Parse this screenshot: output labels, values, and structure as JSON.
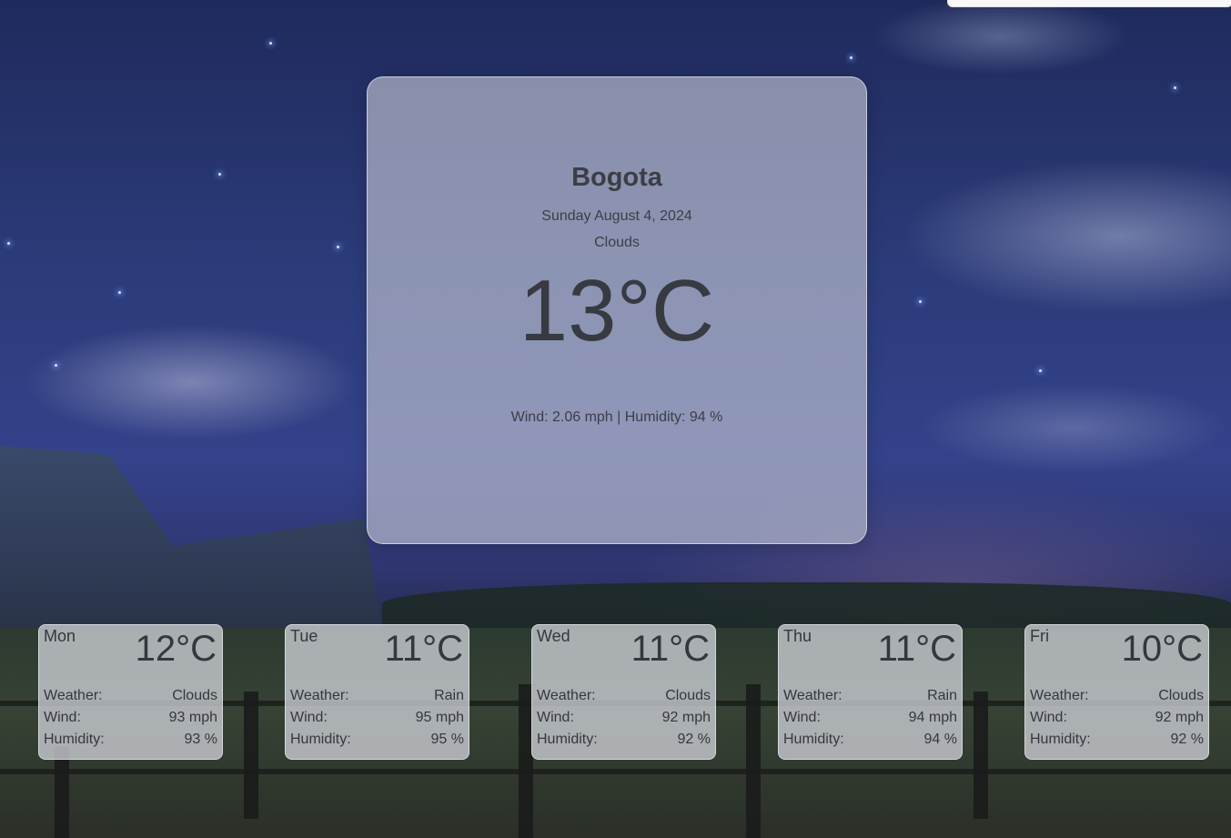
{
  "current": {
    "city": "Bogota",
    "date": "Sunday August 4, 2024",
    "description": "Clouds",
    "temperature": "13°C",
    "details": "Wind: 2.06 mph | Humidity: 94 %"
  },
  "forecast": [
    {
      "day": "Mon",
      "temp": "12°C",
      "weather_label": "Weather:",
      "weather": "Clouds",
      "wind_label": "Wind:",
      "wind": "93 mph",
      "humidity_label": "Humidity:",
      "humidity": "93 %"
    },
    {
      "day": "Tue",
      "temp": "11°C",
      "weather_label": "Weather:",
      "weather": "Rain",
      "wind_label": "Wind:",
      "wind": "95 mph",
      "humidity_label": "Humidity:",
      "humidity": "95 %"
    },
    {
      "day": "Wed",
      "temp": "11°C",
      "weather_label": "Weather:",
      "weather": "Clouds",
      "wind_label": "Wind:",
      "wind": "92 mph",
      "humidity_label": "Humidity:",
      "humidity": "92 %"
    },
    {
      "day": "Thu",
      "temp": "11°C",
      "weather_label": "Weather:",
      "weather": "Rain",
      "wind_label": "Wind:",
      "wind": "94 mph",
      "humidity_label": "Humidity:",
      "humidity": "94 %"
    },
    {
      "day": "Fri",
      "temp": "10°C",
      "weather_label": "Weather:",
      "weather": "Clouds",
      "wind_label": "Wind:",
      "wind": "92 mph",
      "humidity_label": "Humidity:",
      "humidity": "92 %"
    }
  ]
}
